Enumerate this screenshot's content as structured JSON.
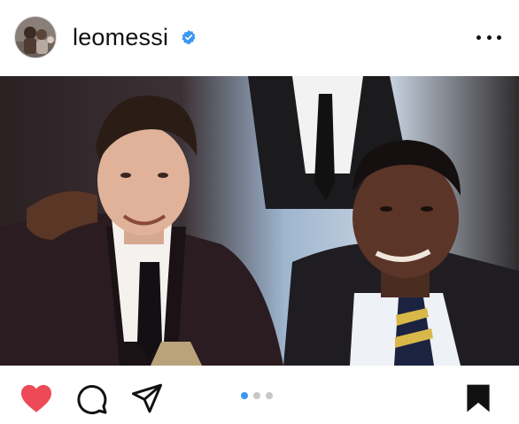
{
  "post": {
    "username": "leomessi",
    "verified": true,
    "avatar_icon": "profile-photo",
    "more_icon": "more-options-icon",
    "photo_description_icon": "post-photo",
    "carousel": {
      "count": 3,
      "active_index": 0
    }
  },
  "actions": {
    "like_icon": "heart-icon",
    "comment_icon": "comment-icon",
    "share_icon": "send-icon",
    "save_icon": "bookmark-icon",
    "like_color": "#ed4956",
    "accent_color": "#3897f0"
  }
}
